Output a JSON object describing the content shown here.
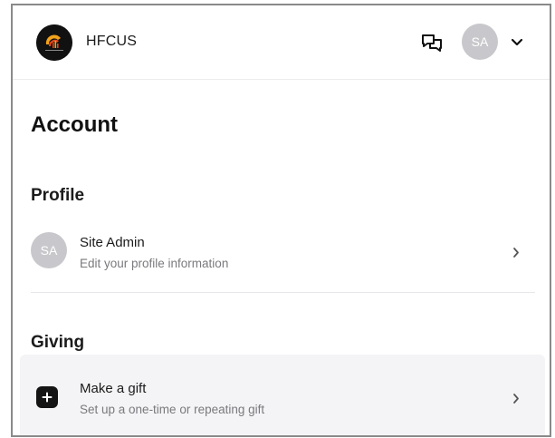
{
  "header": {
    "org_name": "HFCUS",
    "logo_icon": "church-logo",
    "chat_icon": "chat-bubbles-icon",
    "user_initials": "SA",
    "menu_icon": "chevron-down-icon"
  },
  "page": {
    "title": "Account"
  },
  "profile": {
    "section_title": "Profile",
    "avatar_initials": "SA",
    "name": "Site Admin",
    "description": "Edit your profile information"
  },
  "giving": {
    "section_title": "Giving",
    "item_icon": "plus-icon",
    "item_label": "Make a gift",
    "item_description": "Set up a one-time or repeating gift"
  },
  "colors": {
    "avatar_bg": "#c8c8cc",
    "gift_row_bg": "#f4f4f6",
    "text_primary": "#1b1b1b",
    "text_secondary": "#7a7a7e"
  }
}
